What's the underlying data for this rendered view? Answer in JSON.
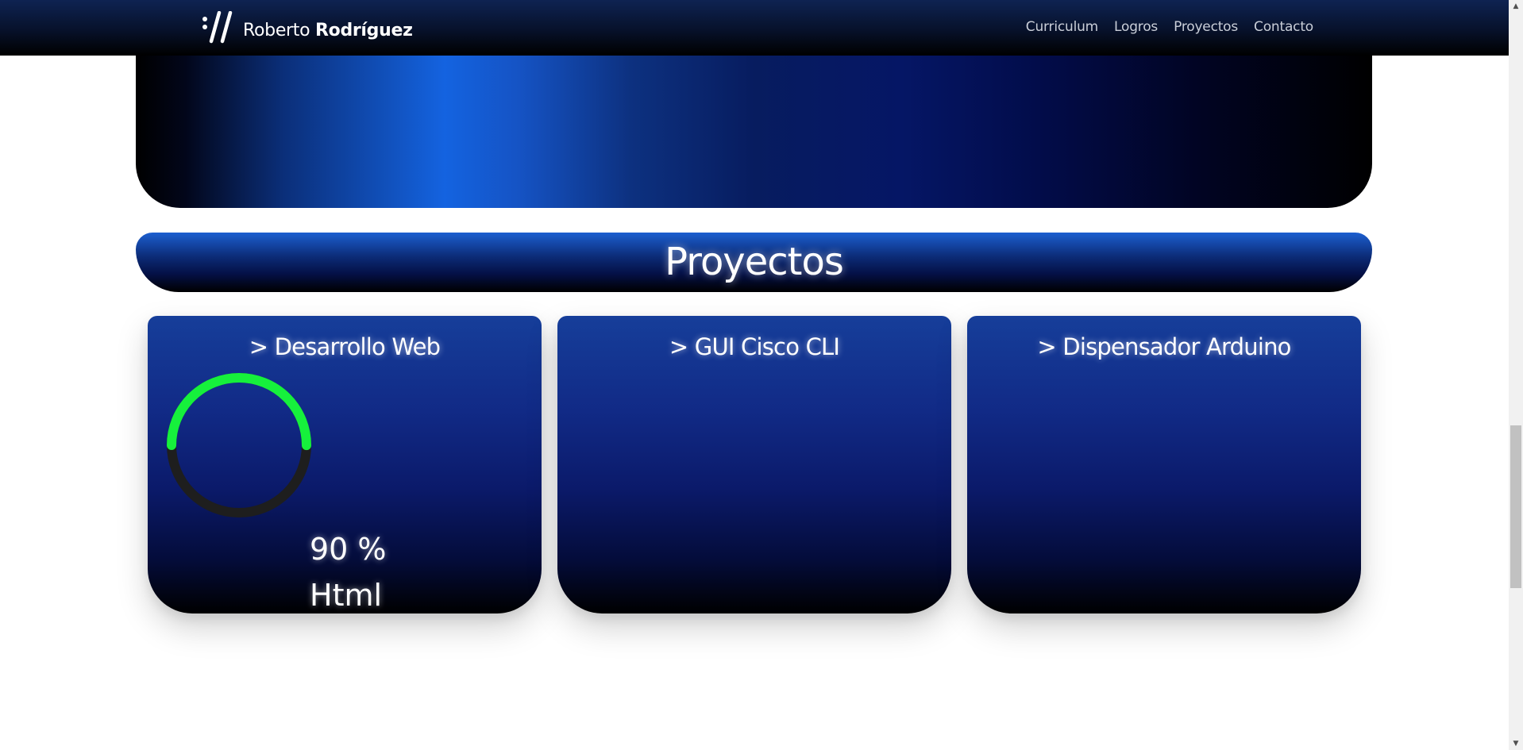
{
  "navbar": {
    "brand_first": "Roberto ",
    "brand_last": "Rodríguez",
    "links": [
      "Curriculum",
      "Logros",
      "Proyectos",
      "Contacto"
    ]
  },
  "projects": {
    "title": "Proyectos",
    "cards": [
      {
        "title": "> Desarrollo Web",
        "skill": {
          "percent": 90,
          "percent_label": "90 %",
          "name": "Html",
          "ring_color": "#16f03c",
          "track_color": "#1e1e1e"
        }
      },
      {
        "title": "> GUI Cisco CLI"
      },
      {
        "title": "> Dispensador Arduino"
      }
    ]
  },
  "colors": {
    "accent_blue": "#1463e0",
    "progress_green": "#16f03c"
  },
  "scrollbar": {
    "up_icon": "arrow-up-icon",
    "down_icon": "arrow-down-icon"
  }
}
